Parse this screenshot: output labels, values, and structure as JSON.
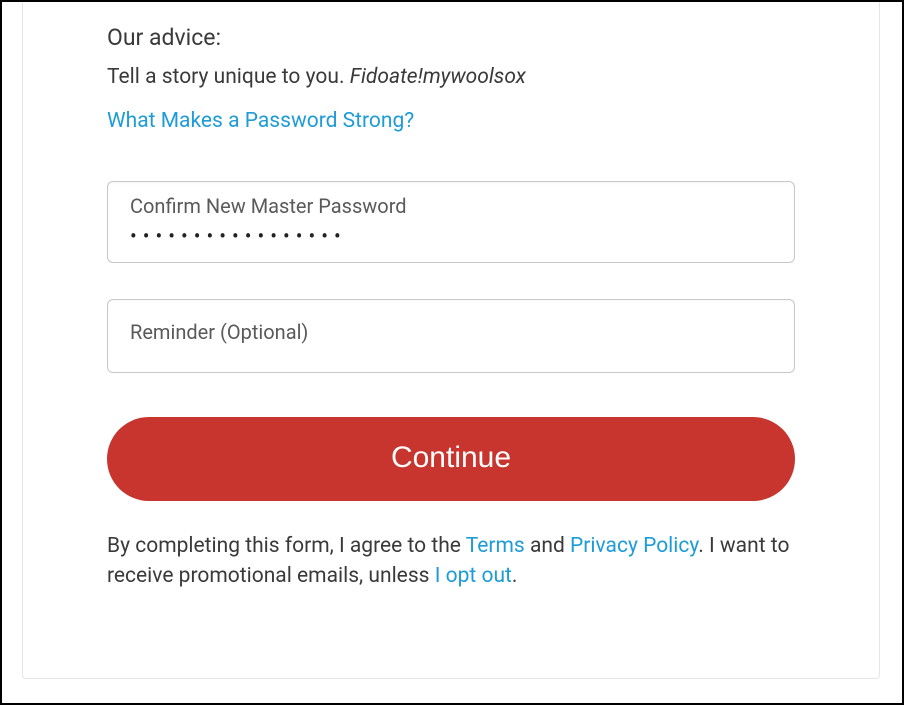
{
  "advice": {
    "heading": "Our advice:",
    "text_prefix": "Tell a story unique to you. ",
    "example": "Fidoate!mywoolsox"
  },
  "help_link": {
    "label": "What Makes a Password Strong?"
  },
  "confirm_password": {
    "label": "Confirm New Master Password",
    "masked_value": "•••••••••••••••••"
  },
  "reminder": {
    "label": "Reminder (Optional)",
    "value": ""
  },
  "continue_button": {
    "label": "Continue"
  },
  "legal": {
    "prefix": "By completing this form, I agree to the ",
    "terms_label": "Terms",
    "and": " and ",
    "privacy_label": "Privacy Policy",
    "middle": ". I want to receive promotional emails, unless ",
    "opt_out_label": "I opt out",
    "suffix": "."
  }
}
